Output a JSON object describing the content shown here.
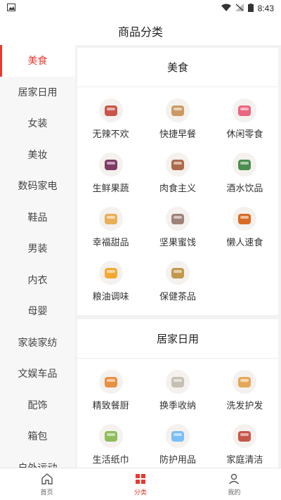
{
  "status": {
    "time": "8:43"
  },
  "header": {
    "title": "商品分类"
  },
  "sidebar": {
    "items": [
      {
        "label": "美食"
      },
      {
        "label": "居家日用"
      },
      {
        "label": "女装"
      },
      {
        "label": "美妆"
      },
      {
        "label": "数码家电"
      },
      {
        "label": "鞋品"
      },
      {
        "label": "男装"
      },
      {
        "label": "内衣"
      },
      {
        "label": "母婴"
      },
      {
        "label": "家装家纺"
      },
      {
        "label": "文娱车品"
      },
      {
        "label": "配饰"
      },
      {
        "label": "箱包"
      },
      {
        "label": "户外运动"
      }
    ],
    "active_index": 0
  },
  "sections": [
    {
      "title": "美食",
      "items": [
        {
          "label": "无辣不欢",
          "icon": "spicy-meat-icon",
          "color": "#c0392b"
        },
        {
          "label": "快捷早餐",
          "icon": "bread-icon",
          "color": "#c48a4a"
        },
        {
          "label": "休闲零食",
          "icon": "snack-bag-icon",
          "color": "#e74c6c"
        },
        {
          "label": "生鲜果蔬",
          "icon": "fruit-icon",
          "color": "#6a1b4d"
        },
        {
          "label": "肉食主义",
          "icon": "meat-box-icon",
          "color": "#a0522d"
        },
        {
          "label": "酒水饮品",
          "icon": "drinks-icon",
          "color": "#2e7d32"
        },
        {
          "label": "幸福甜品",
          "icon": "dessert-icon",
          "color": "#e6a23c"
        },
        {
          "label": "坚果蜜饯",
          "icon": "nuts-icon",
          "color": "#8d6e63"
        },
        {
          "label": "懒人速食",
          "icon": "noodle-icon",
          "color": "#d35400"
        },
        {
          "label": "粮油调味",
          "icon": "oil-icon",
          "color": "#f39c12"
        },
        {
          "label": "保健茶品",
          "icon": "tea-icon",
          "color": "#b7892f"
        }
      ]
    },
    {
      "title": "居家日用",
      "items": [
        {
          "label": "精致餐厨",
          "icon": "pot-icon",
          "color": "#e67e22"
        },
        {
          "label": "换季收纳",
          "icon": "storage-icon",
          "color": "#bdb6a8"
        },
        {
          "label": "洗发护发",
          "icon": "shampoo-icon",
          "color": "#e09b3d"
        },
        {
          "label": "生活纸巾",
          "icon": "tissue-icon",
          "color": "#7cb342"
        },
        {
          "label": "防护用品",
          "icon": "mask-icon",
          "color": "#64b5f6"
        },
        {
          "label": "家庭清洁",
          "icon": "cleaner-icon",
          "color": "#c0392b"
        }
      ]
    }
  ],
  "bottom_nav": [
    {
      "label": "首页",
      "icon": "home-icon"
    },
    {
      "label": "分类",
      "icon": "category-icon"
    },
    {
      "label": "我的",
      "icon": "user-icon"
    }
  ]
}
